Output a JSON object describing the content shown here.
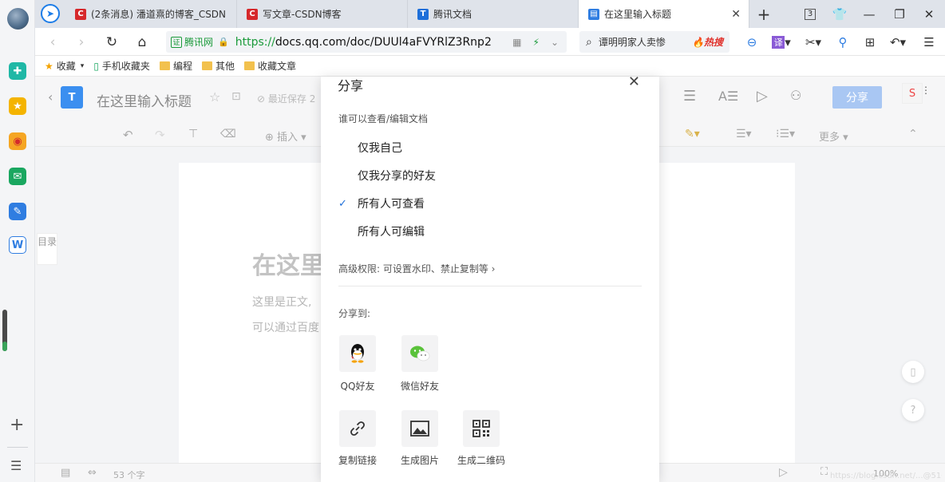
{
  "tabs": [
    {
      "label": "(2条消息) 潘道熹的博客_CSDN",
      "fav": "C",
      "color": "#d6282b",
      "active": false
    },
    {
      "label": "写文章-CSDN博客",
      "fav": "C",
      "color": "#d6282b",
      "active": false
    },
    {
      "label": "腾讯文档",
      "fav": "T",
      "color": "#1e6fd9",
      "active": false
    },
    {
      "label": "在这里输入标题",
      "fav": "▤",
      "color": "#2f7de1",
      "active": true
    }
  ],
  "tabbar": {
    "new_tab": "+",
    "tab_count": "3"
  },
  "address": {
    "site_name": "腾讯网",
    "url_proto": "https://",
    "url_rest": "docs.qq.com/doc/DUUl4aFVYRlZ3Rnp2",
    "search_query": "谭明明家人卖惨",
    "hot_label": "热搜"
  },
  "bookmarks": [
    {
      "label": "收藏",
      "icon": "star-icon"
    },
    {
      "label": "手机收藏夹",
      "icon": "phone-icon"
    },
    {
      "label": "编程",
      "icon": "folder-icon"
    },
    {
      "label": "其他",
      "icon": "folder-icon"
    },
    {
      "label": "收藏文章",
      "icon": "folder-icon"
    }
  ],
  "doc": {
    "title": "在这里输入标题",
    "save_status": "最近保存 2",
    "share_button": "分享",
    "toolbar_insert": "插入",
    "toolbar_more": "更多",
    "toc_label": "目录",
    "heading": "在这里",
    "body1": "这里是正文,",
    "body2": "可以通过百度",
    "word_count": "53 个字",
    "zoom": "100%",
    "watermark": "https://blog.csdn.net/...@51CTO博客"
  },
  "share_dialog": {
    "title": "分享",
    "who_label": "谁可以查看/编辑文档",
    "options": [
      {
        "label": "仅我自己",
        "checked": false
      },
      {
        "label": "仅我分享的好友",
        "checked": false
      },
      {
        "label": "所有人可查看",
        "checked": true
      },
      {
        "label": "所有人可编辑",
        "checked": false
      }
    ],
    "advanced": "高级权限: 可设置水印、禁止复制等 ›",
    "share_to": "分享到:",
    "targets": [
      {
        "label": "QQ好友",
        "icon": "qq-icon"
      },
      {
        "label": "微信好友",
        "icon": "wechat-icon"
      },
      {
        "label": "复制链接",
        "icon": "link-icon"
      },
      {
        "label": "生成图片",
        "icon": "image-icon"
      },
      {
        "label": "生成二维码",
        "icon": "qrcode-icon"
      }
    ]
  },
  "colors": {
    "accent": "#1e6fd9",
    "csdn": "#d6282b",
    "secure": "#1a9a3a"
  }
}
